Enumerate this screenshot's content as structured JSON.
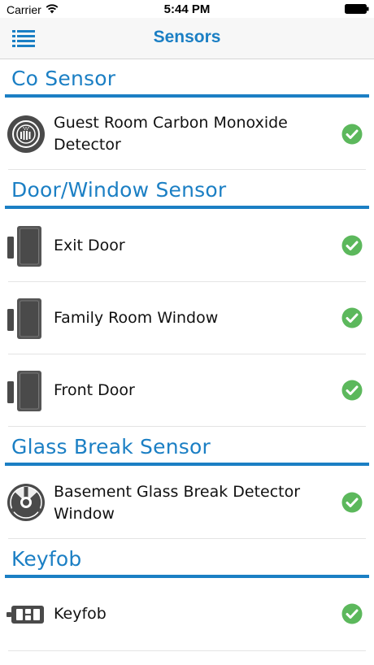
{
  "status_bar": {
    "carrier": "Carrier",
    "time": "5:44 PM",
    "wifi_icon": "wifi-icon",
    "battery_icon": "battery-icon"
  },
  "nav": {
    "title": "Sensors",
    "menu_icon": "list-menu-icon"
  },
  "sections": [
    {
      "title": "Co Sensor",
      "items": [
        {
          "label": "Guest Room Carbon Monoxide Detector",
          "icon": "co-detector-icon",
          "status_icon": "check-icon"
        }
      ]
    },
    {
      "title": "Door/Window Sensor",
      "items": [
        {
          "label": "Exit Door",
          "icon": "door-sensor-icon",
          "status_icon": "check-icon"
        },
        {
          "label": "Family Room Window",
          "icon": "door-sensor-icon",
          "status_icon": "check-icon"
        },
        {
          "label": "Front Door",
          "icon": "door-sensor-icon",
          "status_icon": "check-icon"
        }
      ]
    },
    {
      "title": "Glass Break Sensor",
      "items": [
        {
          "label": "Basement Glass Break Detector Window",
          "icon": "glass-break-icon",
          "status_icon": "check-icon"
        }
      ]
    },
    {
      "title": "Keyfob",
      "items": [
        {
          "label": "Keyfob",
          "icon": "keyfob-icon",
          "status_icon": "check-icon"
        }
      ]
    }
  ],
  "colors": {
    "accent": "#1b7fc4",
    "status_ok": "#5cb85c",
    "icon_gray": "#4a4a4a"
  }
}
